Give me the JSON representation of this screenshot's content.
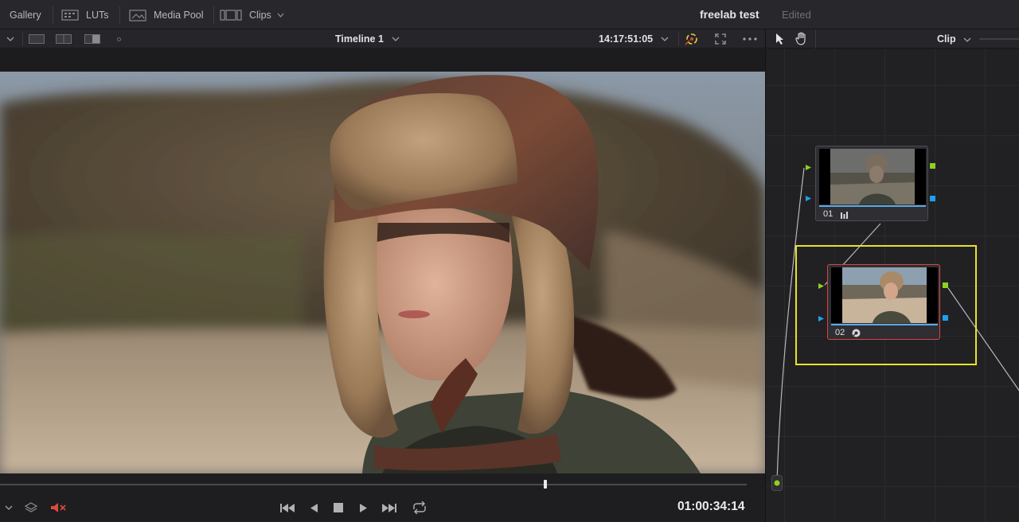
{
  "topbar": {
    "items": [
      {
        "label": "Gallery",
        "icon": "gallery-icon"
      },
      {
        "label": "LUTs",
        "icon": "luts-icon"
      },
      {
        "label": "Media Pool",
        "icon": "media-pool-icon"
      },
      {
        "label": "Clips",
        "icon": "clips-icon"
      }
    ],
    "project_title": "freelab test",
    "project_status": "Edited"
  },
  "viewer": {
    "timeline_name": "Timeline 1",
    "timecode_top": "14:17:51:05",
    "timecode_bottom": "01:00:34:14",
    "playhead_position": 0.73
  },
  "node_editor": {
    "mode": "Clip",
    "nodes": [
      {
        "label": "01",
        "icon": "levels-icon",
        "selected": false
      },
      {
        "label": "02",
        "icon": "color-wheel-icon",
        "selected": true
      }
    ]
  },
  "colors": {
    "accent_blue": "#5aa9e6",
    "selection_yellow": "#e8e22a",
    "active_node_border": "#d8463c",
    "port_green": "#8fd11e",
    "port_blue": "#1fa0e8",
    "mute_red": "#e04a3a"
  }
}
